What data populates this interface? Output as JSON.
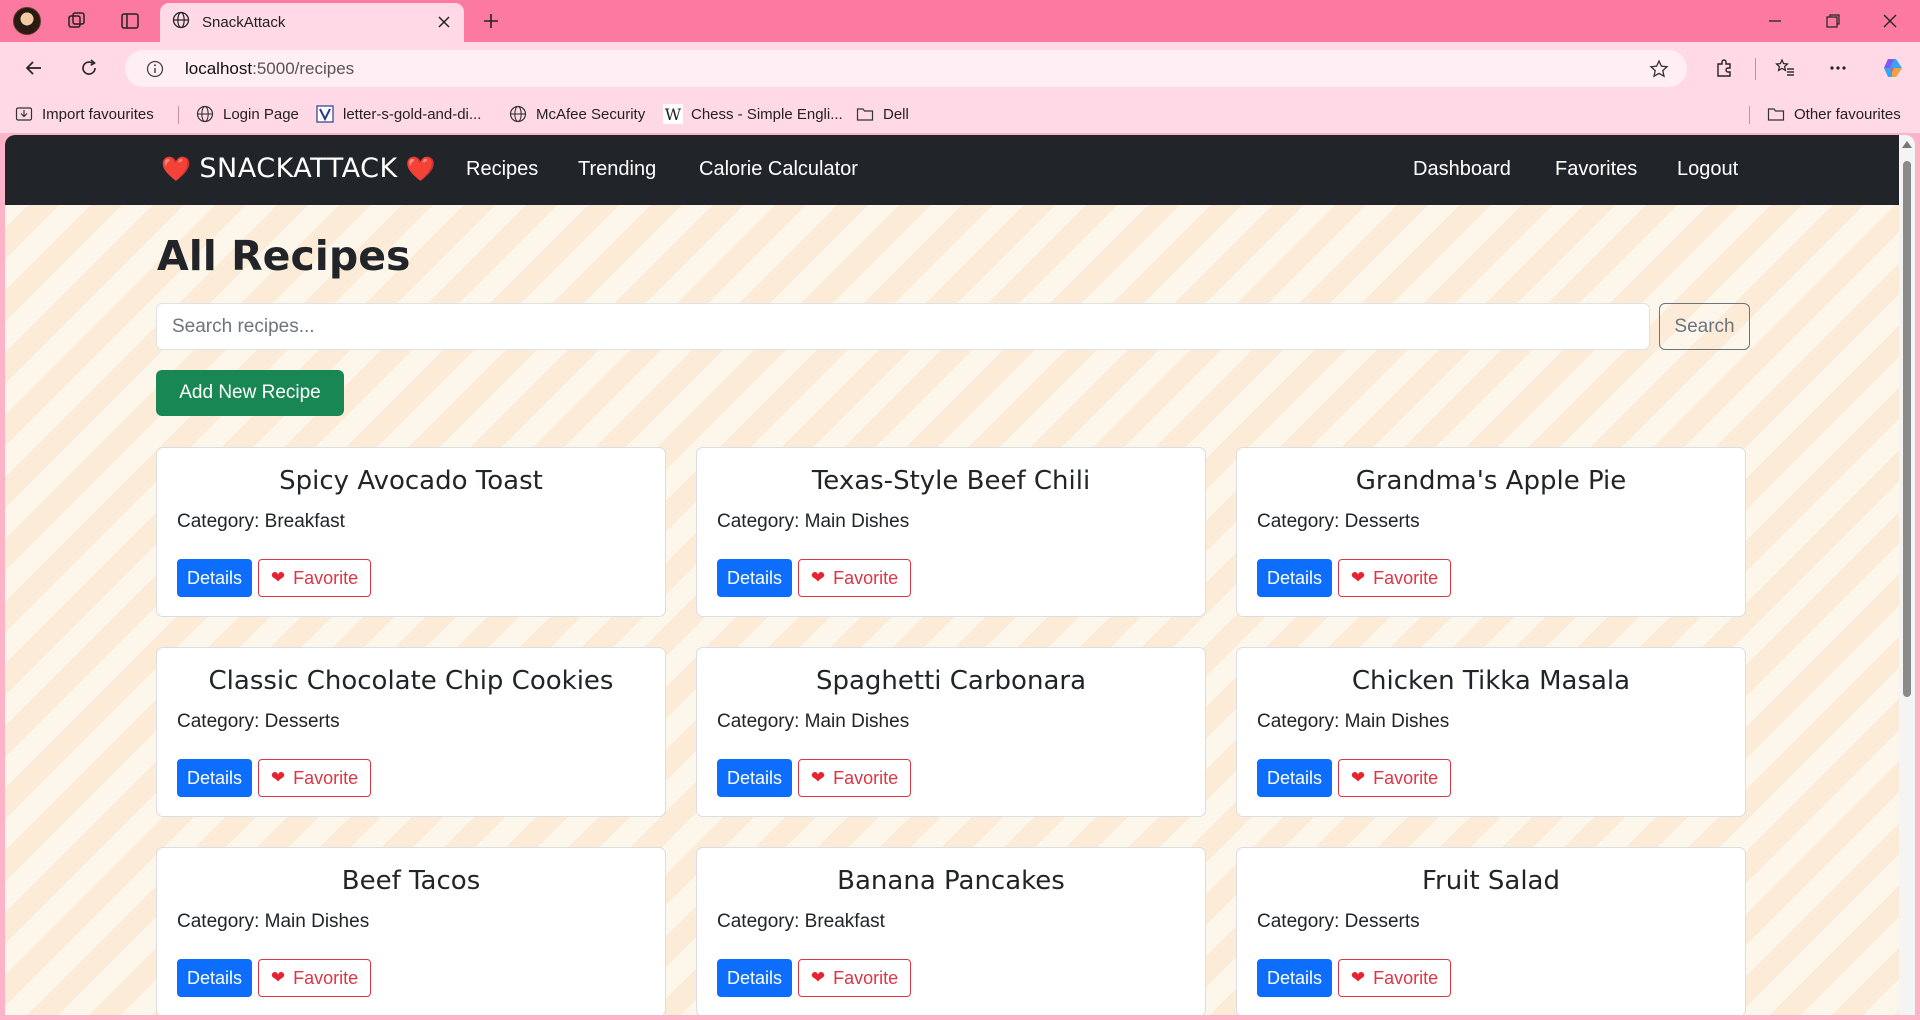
{
  "browser": {
    "tab_title": "SnackAttack",
    "url_host": "localhost",
    "url_path": ":5000/recipes",
    "favorites_bar": [
      {
        "label": "Import favourites",
        "icon": "import-icon"
      },
      {
        "label": "Login Page",
        "icon": "globe-icon"
      },
      {
        "label": "letter-s-gold-and-di...",
        "icon": "vector-logo-icon"
      },
      {
        "label": "McAfee Security",
        "icon": "globe-icon"
      },
      {
        "label": "Chess - Simple Engli...",
        "icon": "wikipedia-icon"
      },
      {
        "label": "Dell",
        "icon": "folder-icon"
      }
    ],
    "other_favourites": "Other favourites"
  },
  "navbar": {
    "brand_left_heart": "❤️",
    "brand": "SNACKATTACK",
    "brand_right_heart": "❤️",
    "links_left": [
      "Recipes",
      "Trending",
      "Calorie Calculator"
    ],
    "links_right": [
      "Dashboard",
      "Favorites",
      "Logout"
    ]
  },
  "page": {
    "title": "All Recipes",
    "search_placeholder": "Search recipes...",
    "search_button": "Search",
    "add_button": "Add New Recipe"
  },
  "recipes": [
    {
      "name": "Spicy Avocado Toast",
      "category": "Category: Breakfast"
    },
    {
      "name": "Texas-Style Beef Chili",
      "category": "Category: Main Dishes"
    },
    {
      "name": "Grandma's Apple Pie",
      "category": "Category: Desserts"
    },
    {
      "name": "Classic Chocolate Chip Cookies",
      "category": "Category: Desserts"
    },
    {
      "name": "Spaghetti Carbonara",
      "category": "Category: Main Dishes"
    },
    {
      "name": "Chicken Tikka Masala",
      "category": "Category: Main Dishes"
    },
    {
      "name": "Beef Tacos",
      "category": "Category: Main Dishes"
    },
    {
      "name": "Banana Pancakes",
      "category": "Category: Breakfast"
    },
    {
      "name": "Fruit Salad",
      "category": "Category: Desserts"
    }
  ],
  "card_buttons": {
    "details": "Details",
    "favorite": "Favorite",
    "favorite_heart": "❤"
  },
  "colors": {
    "tab_strip": "#fc7aa0",
    "chrome": "#ffd9e5",
    "navbar": "#212529",
    "details_button": "#0d6efd",
    "favorite_button": "#dc3545",
    "add_button": "#198754"
  }
}
